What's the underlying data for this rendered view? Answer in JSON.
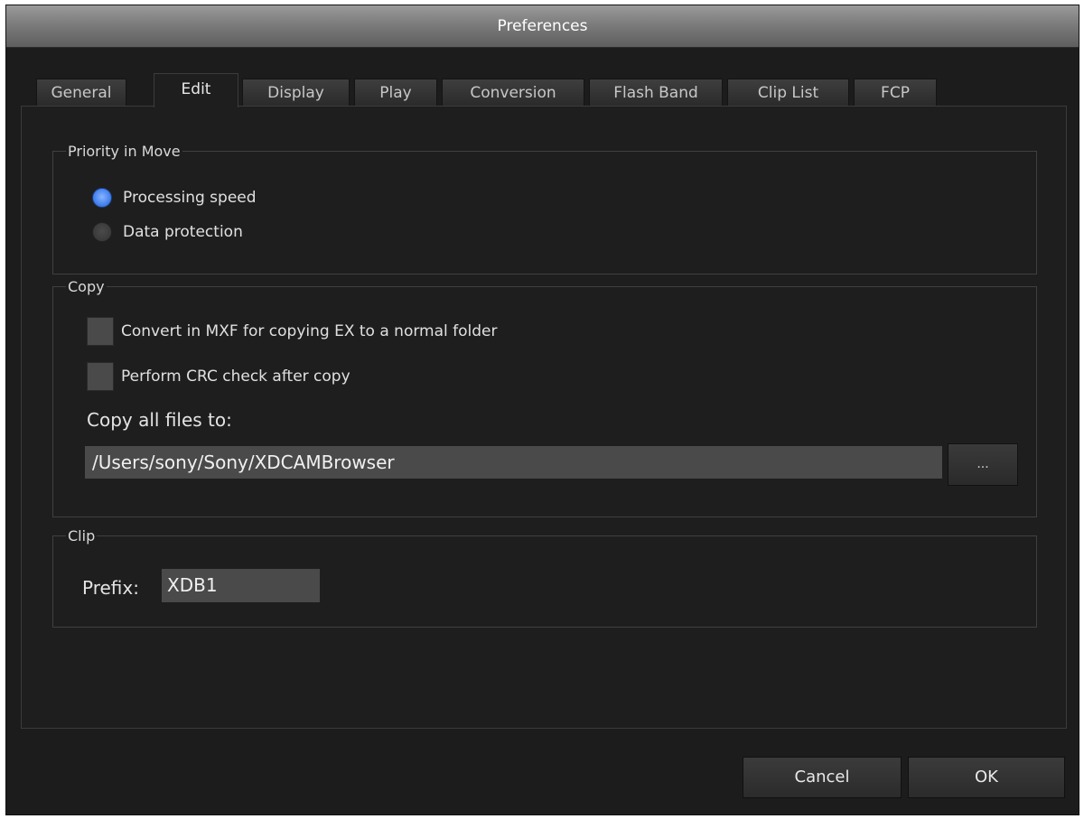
{
  "window": {
    "title": "Preferences"
  },
  "tabs": [
    {
      "label": "General"
    },
    {
      "label": "Edit"
    },
    {
      "label": "Display"
    },
    {
      "label": "Play"
    },
    {
      "label": "Conversion"
    },
    {
      "label": "Flash Band"
    },
    {
      "label": "Clip List"
    },
    {
      "label": "FCP"
    }
  ],
  "active_tab": "Edit",
  "priority": {
    "legend": "Priority in Move",
    "options": [
      {
        "label": "Processing speed",
        "selected": true
      },
      {
        "label": "Data protection",
        "selected": false
      }
    ]
  },
  "copy": {
    "legend": "Copy",
    "checkboxes": [
      {
        "label": "Convert in MXF for copying EX to a normal folder",
        "checked": false
      },
      {
        "label": "Perform CRC check after copy",
        "checked": false
      }
    ],
    "dest_label": "Copy all files to:",
    "dest_path": "/Users/sony/Sony/XDCAMBrowser",
    "browse_label": "..."
  },
  "clip": {
    "legend": "Clip",
    "prefix_label": "Prefix:",
    "prefix_value": "XDB1"
  },
  "buttons": {
    "cancel": "Cancel",
    "ok": "OK"
  },
  "colors": {
    "accent_radio": "#4a86f0",
    "background": "#1c1c1c"
  }
}
